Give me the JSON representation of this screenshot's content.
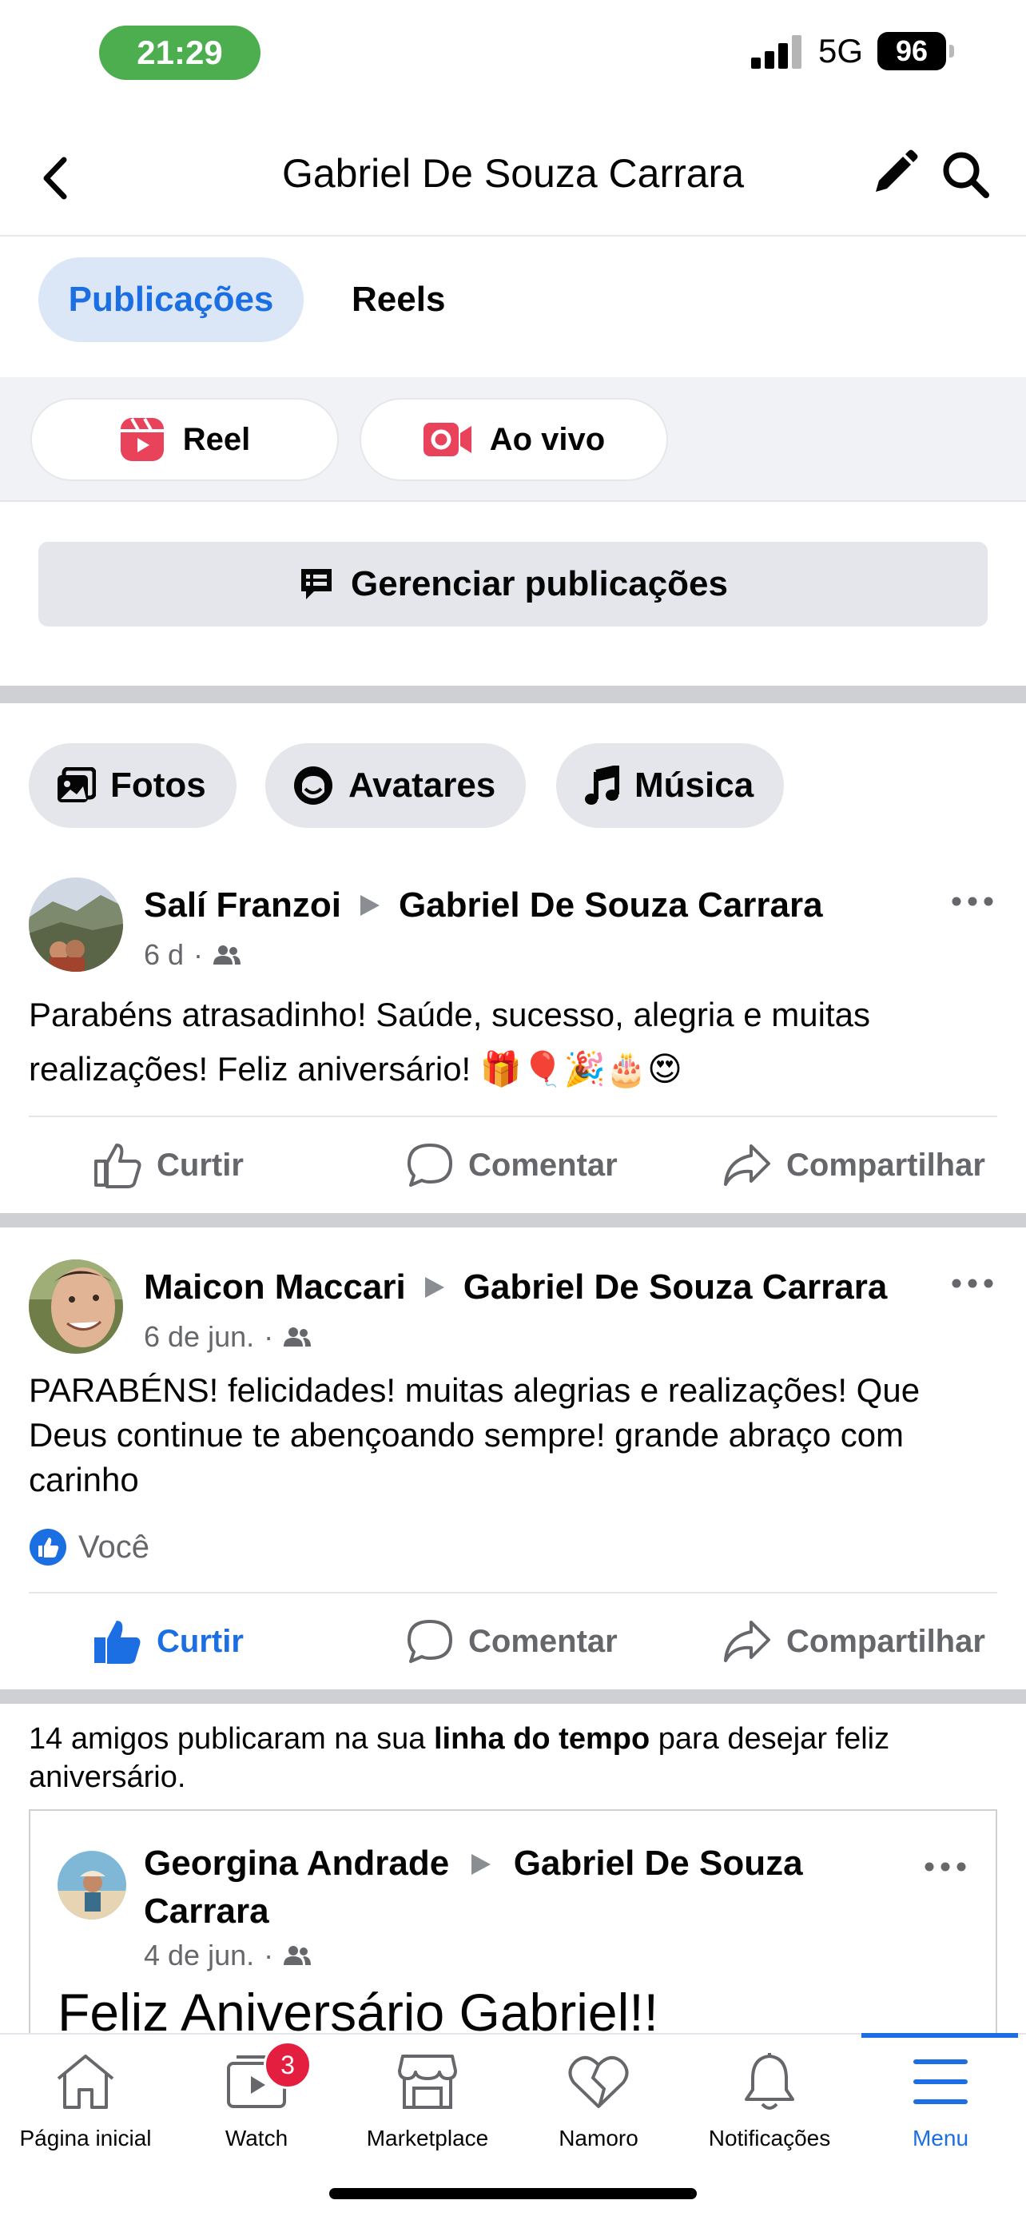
{
  "status_bar": {
    "time": "21:29",
    "network": "5G",
    "battery": "96"
  },
  "header": {
    "title": "Gabriel De Souza Carrara"
  },
  "tabs": [
    {
      "label": "Publicações",
      "active": true
    },
    {
      "label": "Reels",
      "active": false
    }
  ],
  "create": {
    "reel_label": "Reel",
    "live_label": "Ao vivo"
  },
  "manage": {
    "label": "Gerenciar publicações"
  },
  "filters": [
    {
      "label": "Fotos",
      "icon": "photos-icon"
    },
    {
      "label": "Avatares",
      "icon": "avatar-icon"
    },
    {
      "label": "Música",
      "icon": "music-icon"
    }
  ],
  "posts": [
    {
      "author": "Salí Franzoi",
      "target": "Gabriel De Souza Carrara",
      "time": "6 d",
      "text": "Parabéns atrasadinho! Saúde, sucesso, alegria e muitas realizações! Feliz aniversário! 🎁🎈🎉🎂😍",
      "liked": false
    },
    {
      "author": "Maicon Maccari",
      "target": "Gabriel De Souza Carrara",
      "time": "6 de jun.",
      "text": "PARABÉNS! felicidades! muitas alegrias e realizações! Que Deus continue te abençoando sempre! grande abraço com carinho",
      "reactions": "Você",
      "liked": true
    }
  ],
  "actions": {
    "like": "Curtir",
    "comment": "Comentar",
    "share": "Compartilhar"
  },
  "summary": {
    "prefix": "14 amigos publicaram na sua ",
    "bold": "linha do tempo",
    "suffix": " para desejar feliz aniversário."
  },
  "nested_post": {
    "author": "Georgina Andrade",
    "target_line1": "Gabriel De Souza",
    "target_line2": "Carrara",
    "time": "4 de jun.",
    "text": "Feliz Aniversário Gabriel!!"
  },
  "bottom_nav": [
    {
      "label": "Página inicial",
      "icon": "home-icon"
    },
    {
      "label": "Watch",
      "icon": "watch-icon",
      "badge": "3"
    },
    {
      "label": "Marketplace",
      "icon": "marketplace-icon"
    },
    {
      "label": "Namoro",
      "icon": "dating-icon"
    },
    {
      "label": "Notificações",
      "icon": "bell-icon"
    },
    {
      "label": "Menu",
      "icon": "menu-icon",
      "active": true
    }
  ],
  "colors": {
    "accent": "#1b6fe3",
    "chip_bg": "#e4e6eb",
    "secondary_text": "#65676b",
    "reel_red": "#e8435a"
  }
}
